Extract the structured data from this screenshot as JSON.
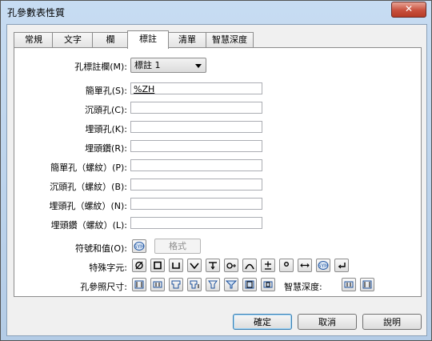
{
  "window": {
    "title": "孔參數表性質",
    "close_symbol": "✕"
  },
  "tabs": [
    {
      "label": "常規"
    },
    {
      "label": "文字"
    },
    {
      "label": "欄"
    },
    {
      "label": "標註"
    },
    {
      "label": "清單"
    },
    {
      "label": "智慧深度"
    }
  ],
  "active_tab": "標註",
  "form": {
    "column_label": "孔標註欄(M):",
    "column_value": "標註 1",
    "fields": [
      {
        "label": "簡單孔(S):",
        "value": "%ZH"
      },
      {
        "label": "沉頭孔(C):",
        "value": ""
      },
      {
        "label": "埋頭孔(K):",
        "value": ""
      },
      {
        "label": "埋頭鑽(R):",
        "value": ""
      },
      {
        "label": "簡單孔（螺紋）(P):",
        "value": ""
      },
      {
        "label": "沉頭孔（螺紋）(B):",
        "value": ""
      },
      {
        "label": "埋頭孔（螺紋）(N):",
        "value": ""
      },
      {
        "label": "埋頭鑽（螺紋）(L):",
        "value": ""
      }
    ],
    "symbols_label": "符號和值(O):",
    "format_button": "格式",
    "special_chars_label": "特殊字元:",
    "special_chars": [
      "diameter-icon",
      "square-icon",
      "counterbore-icon",
      "countersink-icon",
      "depth-icon",
      "thread-icon",
      "arc-icon",
      "plus-minus-icon",
      "degree-icon",
      "between-icon",
      "sym-icon",
      "return-icon"
    ],
    "hole_ref_label": "孔參照尺寸:",
    "hole_refs": [
      "hole-dim-1-icon",
      "hole-dim-2-icon",
      "hole-dim-3-icon",
      "hole-dim-4-icon",
      "hole-dim-5-icon",
      "hole-dim-6-icon",
      "hole-dim-7-icon",
      "hole-dim-8-icon"
    ],
    "smart_depth_label": "智慧深度:",
    "smart_depth": [
      "smart-depth-1-icon",
      "smart-depth-2-icon"
    ]
  },
  "buttons": {
    "ok": "確定",
    "cancel": "取消",
    "help": "說明"
  }
}
